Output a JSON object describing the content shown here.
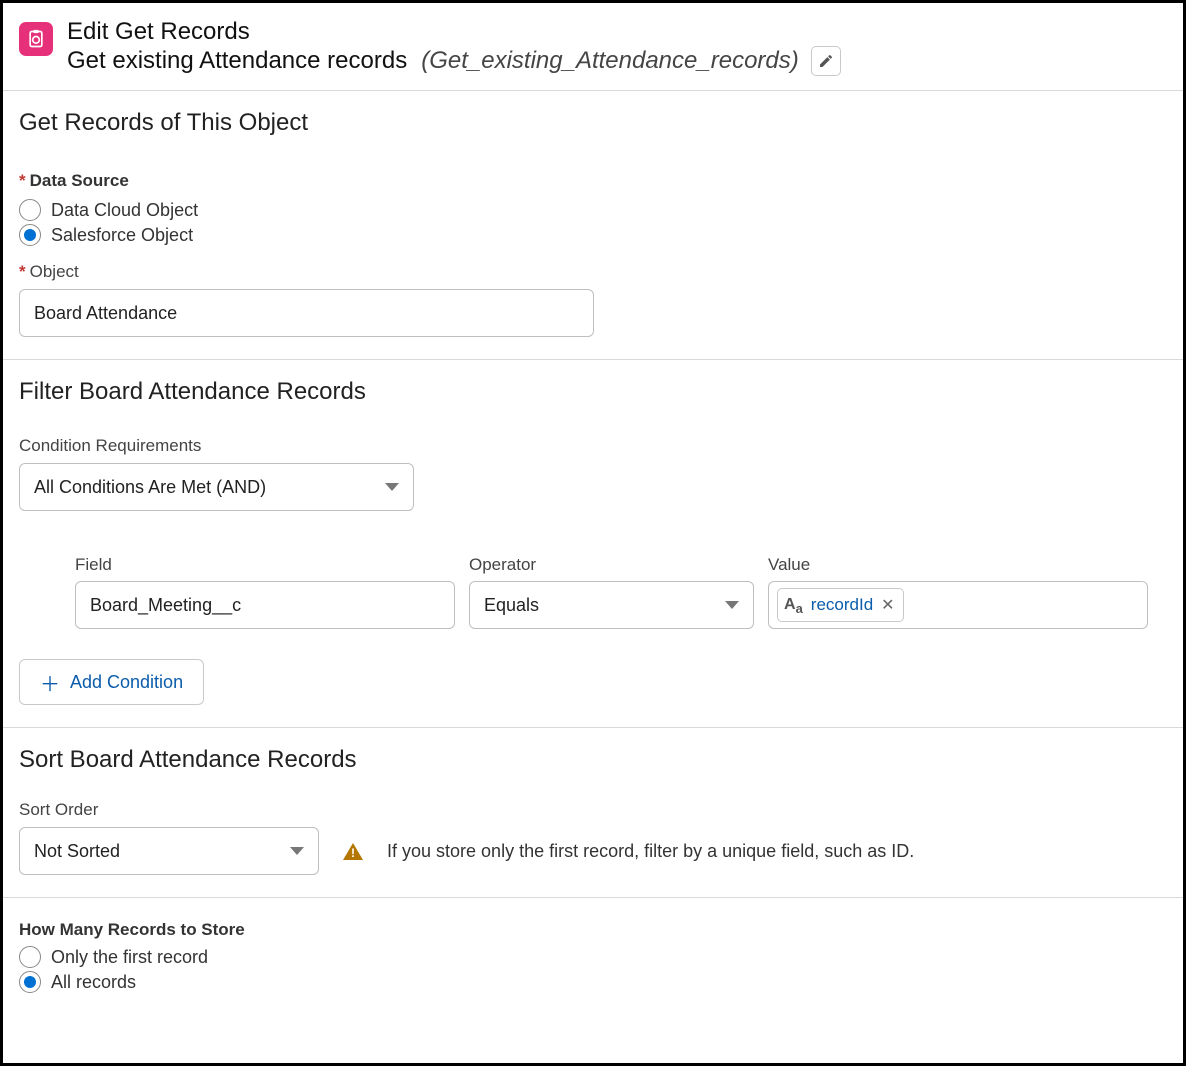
{
  "header": {
    "title": "Edit Get Records",
    "subtitle": "Get existing Attendance records",
    "api_name": "(Get_existing_Attendance_records)"
  },
  "section_object": {
    "title": "Get Records of This Object",
    "data_source_label": "Data Source",
    "data_source_options": {
      "cloud": "Data Cloud Object",
      "sf": "Salesforce Object"
    },
    "data_source_selected": "sf",
    "object_label": "Object",
    "object_value": "Board Attendance"
  },
  "section_filter": {
    "title": "Filter Board Attendance Records",
    "cond_req_label": "Condition Requirements",
    "cond_req_value": "All Conditions Are Met (AND)",
    "columns": {
      "field": "Field",
      "operator": "Operator",
      "value": "Value"
    },
    "rows": [
      {
        "field": "Board_Meeting__c",
        "operator": "Equals",
        "value": "recordId"
      }
    ],
    "add_label": "Add Condition"
  },
  "section_sort": {
    "title": "Sort Board Attendance Records",
    "sort_order_label": "Sort Order",
    "sort_order_value": "Not Sorted",
    "hint": "If you store only the first record, filter by a unique field, such as ID."
  },
  "section_store": {
    "label": "How Many Records to Store",
    "options": {
      "first": "Only the first record",
      "all": "All records"
    },
    "selected": "all"
  }
}
